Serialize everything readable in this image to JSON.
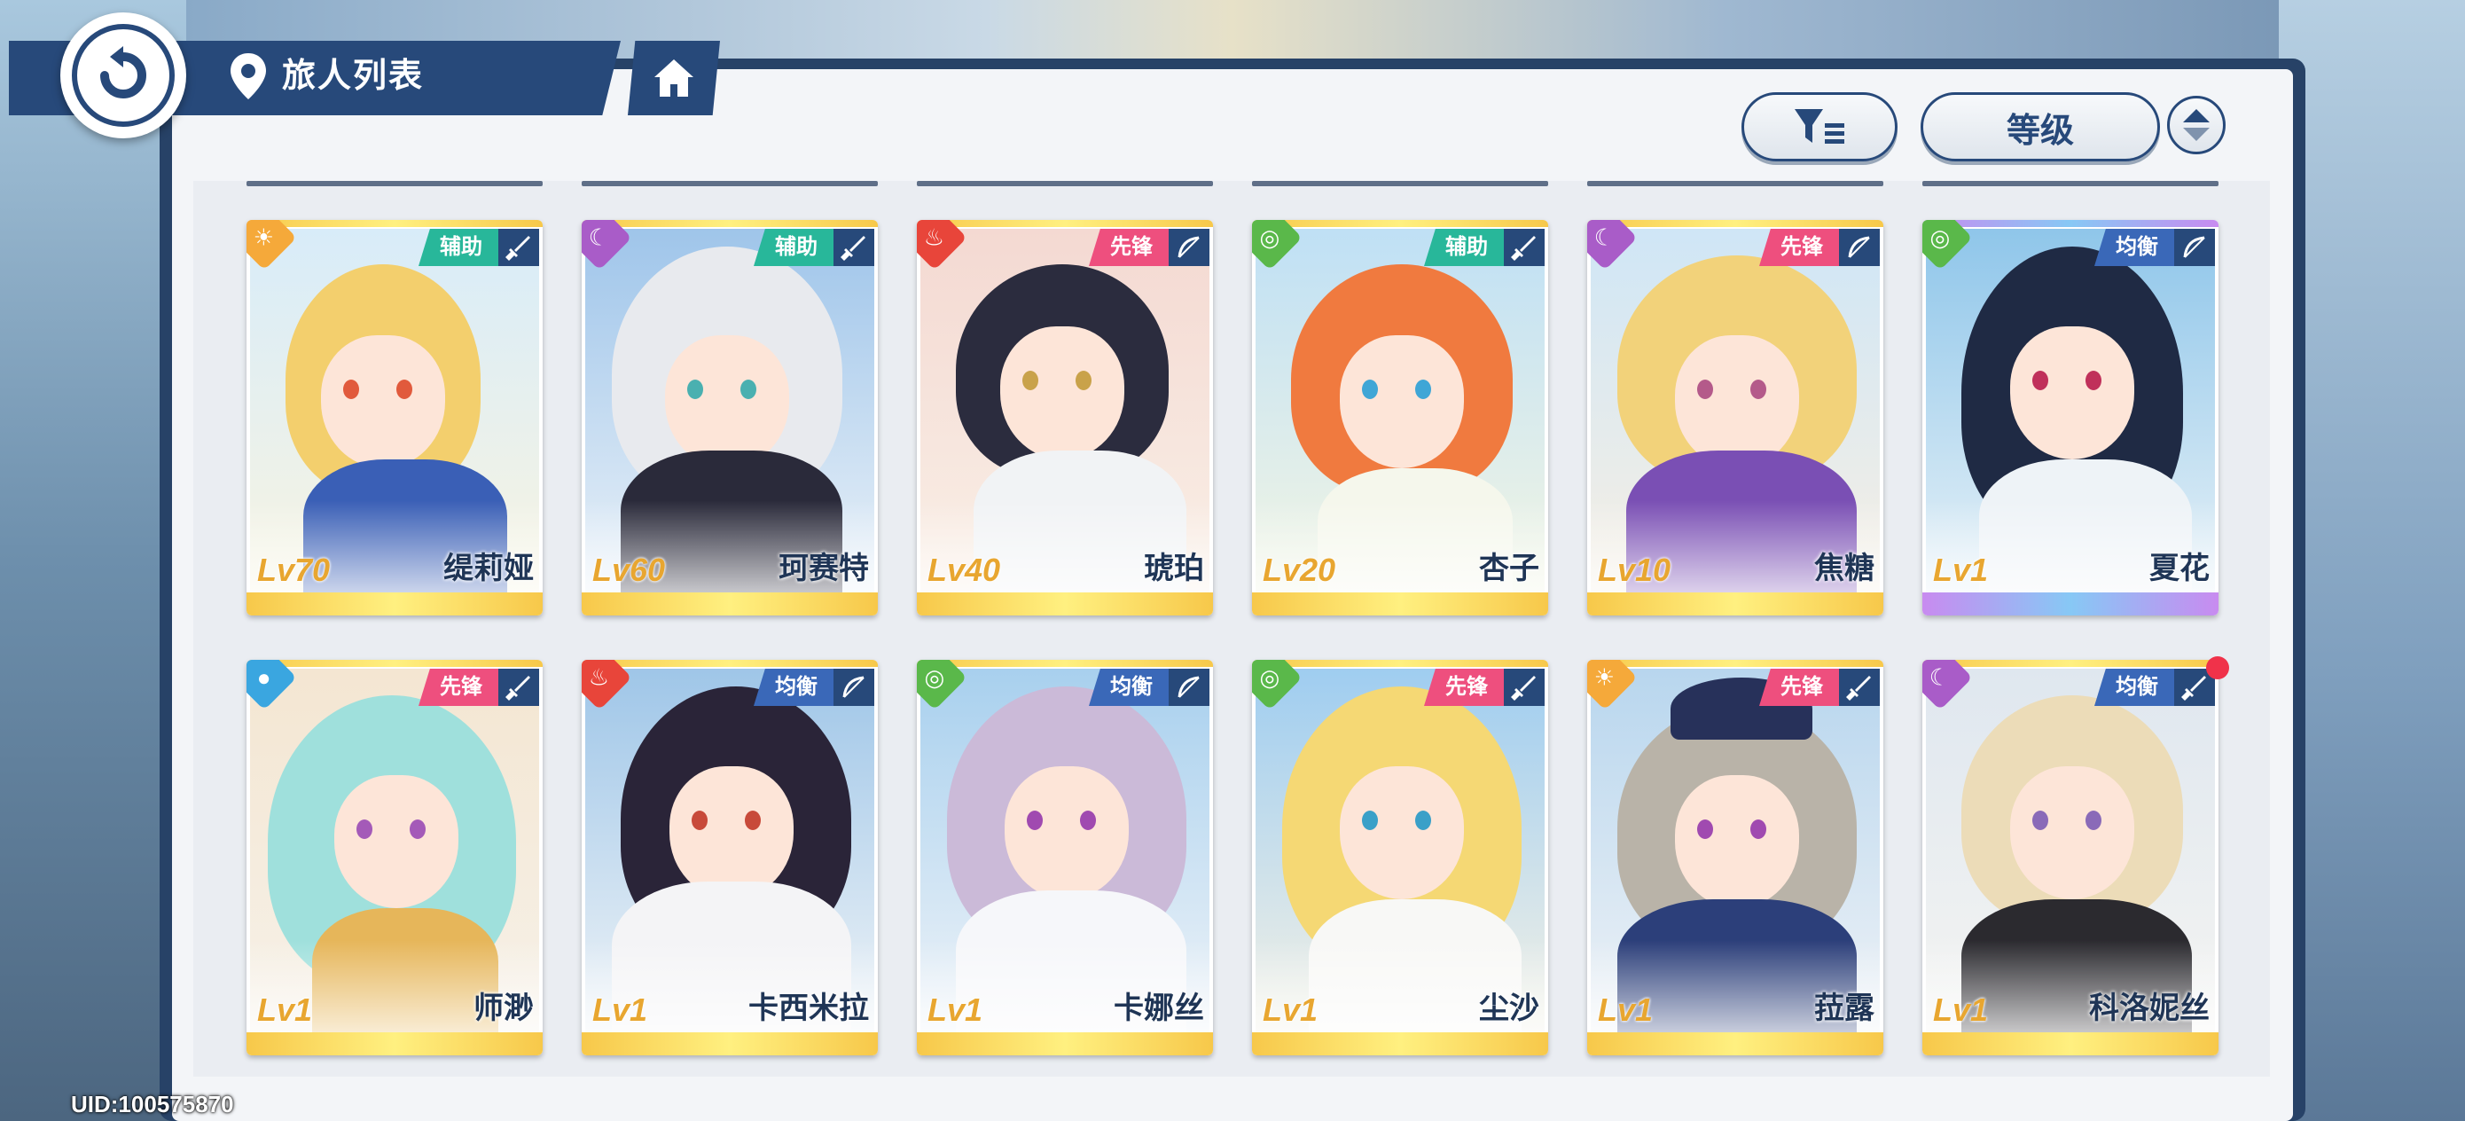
{
  "header": {
    "title": "旅人列表",
    "sort_label": "等级"
  },
  "uid": "UID:100575870",
  "colors": {
    "navy": "#27497a",
    "support": "#28b79a",
    "vanguard": "#ee4f7e",
    "balance": "#3a68b8"
  },
  "characters": [
    {
      "level": "Lv70",
      "name": "缇莉娅",
      "role": "辅助",
      "element": "sun",
      "weapon": "sword"
    },
    {
      "level": "Lv60",
      "name": "珂赛特",
      "role": "辅助",
      "element": "moon",
      "weapon": "sword"
    },
    {
      "level": "Lv40",
      "name": "琥珀",
      "role": "先锋",
      "element": "fire",
      "weapon": "bow"
    },
    {
      "level": "Lv20",
      "name": "杏子",
      "role": "辅助",
      "element": "wind",
      "weapon": "sword"
    },
    {
      "level": "Lv10",
      "name": "焦糖",
      "role": "先锋",
      "element": "moon",
      "weapon": "bow"
    },
    {
      "level": "Lv1",
      "name": "夏花",
      "role": "均衡",
      "element": "wind",
      "weapon": "bow"
    },
    {
      "level": "Lv1",
      "name": "师渺",
      "role": "先锋",
      "element": "water",
      "weapon": "sword"
    },
    {
      "level": "Lv1",
      "name": "卡西米拉",
      "role": "均衡",
      "element": "fire",
      "weapon": "bow"
    },
    {
      "level": "Lv1",
      "name": "卡娜丝",
      "role": "均衡",
      "element": "wind",
      "weapon": "bow"
    },
    {
      "level": "Lv1",
      "name": "尘沙",
      "role": "先锋",
      "element": "wind",
      "weapon": "sword"
    },
    {
      "level": "Lv1",
      "name": "菈露",
      "role": "先锋",
      "element": "sun",
      "weapon": "sword"
    },
    {
      "level": "Lv1",
      "name": "科洛妮丝",
      "role": "均衡",
      "element": "moon",
      "weapon": "sword"
    }
  ]
}
